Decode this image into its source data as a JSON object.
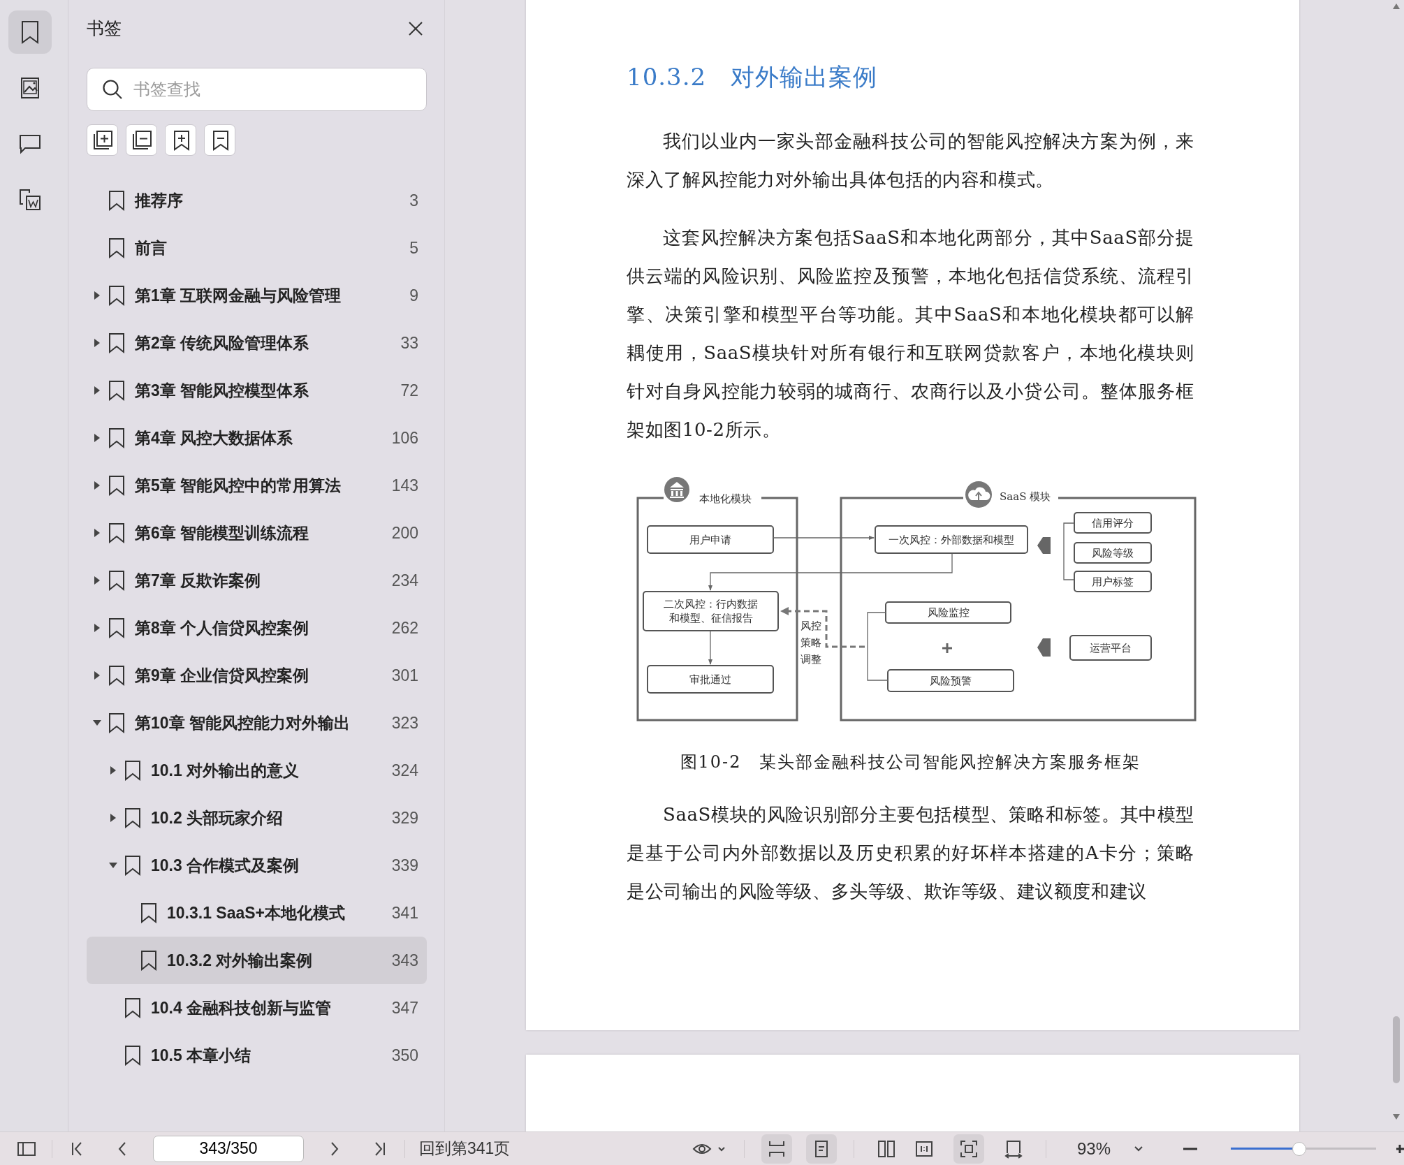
{
  "rail": [
    {
      "kind": "bookmarks",
      "selected": true
    },
    {
      "kind": "images",
      "selected": false
    },
    {
      "kind": "comments",
      "selected": false
    },
    {
      "kind": "convert",
      "selected": false
    }
  ],
  "bookmarks_panel": {
    "title": "书签",
    "search": {
      "placeholder": "书签查找"
    },
    "items": [
      {
        "title": "推荐序",
        "page": "3",
        "selected": false
      },
      {
        "title": "前言",
        "page": "5",
        "selected": false
      },
      {
        "title": "第1章 互联网金融与风险管理",
        "page": "9",
        "expanded": false,
        "selected": false
      },
      {
        "title": "第2章 传统风险管理体系",
        "page": "33",
        "expanded": false,
        "selected": false
      },
      {
        "title": "第3章 智能风控模型体系",
        "page": "72",
        "expanded": false,
        "selected": false
      },
      {
        "title": "第4章 风控大数据体系",
        "page": "106",
        "expanded": false,
        "selected": false
      },
      {
        "title": "第5章 智能风控中的常用算法",
        "page": "143",
        "expanded": false,
        "selected": false
      },
      {
        "title": "第6章 智能模型训练流程",
        "page": "200",
        "expanded": false,
        "selected": false
      },
      {
        "title": "第7章 反欺诈案例",
        "page": "234",
        "expanded": false,
        "selected": false
      },
      {
        "title": "第8章 个人信贷风控案例",
        "page": "262",
        "expanded": false,
        "selected": false
      },
      {
        "title": "第9章 企业信贷风控案例",
        "page": "301",
        "expanded": false,
        "selected": false
      },
      {
        "title": "第10章 智能风控能力对外输出",
        "page": "323",
        "expanded": true,
        "selected": false,
        "children": [
          {
            "title": "10.1 对外输出的意义",
            "page": "324",
            "expanded": false,
            "selected": false
          },
          {
            "title": "10.2 头部玩家介绍",
            "page": "329",
            "expanded": false,
            "selected": false
          },
          {
            "title": "10.3 合作模式及案例",
            "page": "339",
            "expanded": true,
            "selected": false,
            "children": [
              {
                "title": "10.3.1 SaaS+本地化模式",
                "page": "341",
                "selected": false
              },
              {
                "title": "10.3.2 对外输出案例",
                "page": "343",
                "selected": true
              }
            ]
          },
          {
            "title": "10.4 金融科技创新与监管",
            "page": "347",
            "selected": false
          },
          {
            "title": "10.5 本章小结",
            "page": "350",
            "selected": false
          }
        ]
      }
    ]
  },
  "document": {
    "heading": "10.3.2　对外输出案例",
    "paragraphs_before": [
      "我们以业内一家头部金融科技公司的智能风控解决方案为例，来深入了解风控能力对外输出具体包括的内容和模式。",
      "这套风控解决方案包括SaaS和本地化两部分，其中SaaS部分提供云端的风险识别、风险监控及预警，本地化包括信贷系统、流程引擎、决策引擎和模型平台等功能。其中SaaS和本地化模块都可以解耦使用，SaaS模块针对所有银行和互联网贷款客户，本地化模块则针对自身风控能力较弱的城商行、农商行以及小贷公司。整体服务框架如图10-2所示。"
    ],
    "figure": {
      "local_label": "本地化模块",
      "saas_label": "SaaS 模块",
      "local_boxes": [
        [
          "用户申请"
        ],
        [
          "二次风控：行内数据",
          "和模型、征信报告"
        ],
        [
          "审批通过"
        ]
      ],
      "first_check": "一次风控：外部数据和模型",
      "outputs": [
        "信用评分",
        "风险等级",
        "用户标签"
      ],
      "monitor_boxes": [
        "风险监控",
        "风险预警"
      ],
      "platform": "运营平台",
      "feedback_label": [
        "风控",
        "策略",
        "调整"
      ]
    },
    "caption": "图10-2　某头部金融科技公司智能风控解决方案服务框架",
    "paragraphs_after": [
      "SaaS模块的风险识别部分主要包括模型、策略和标签。其中模型是基于公司内外部数据以及历史积累的好坏样本搭建的A卡分；策略是公司输出的风险等级、多头等级、欺诈等级、建议额度和建议"
    ]
  },
  "toolbar": {
    "page_field": "343/350",
    "back_link": "回到第341页",
    "view_modes": [
      {
        "kind": "continuous",
        "selected": true
      },
      {
        "kind": "single",
        "selected": true
      },
      {
        "kind": "double",
        "selected": false
      },
      {
        "kind": "actual",
        "selected": false
      },
      {
        "kind": "fit_page",
        "selected": true
      },
      {
        "kind": "fit_width",
        "selected": false
      }
    ],
    "zoom": "93%",
    "zoom_slider": {
      "level": 0.47
    }
  }
}
